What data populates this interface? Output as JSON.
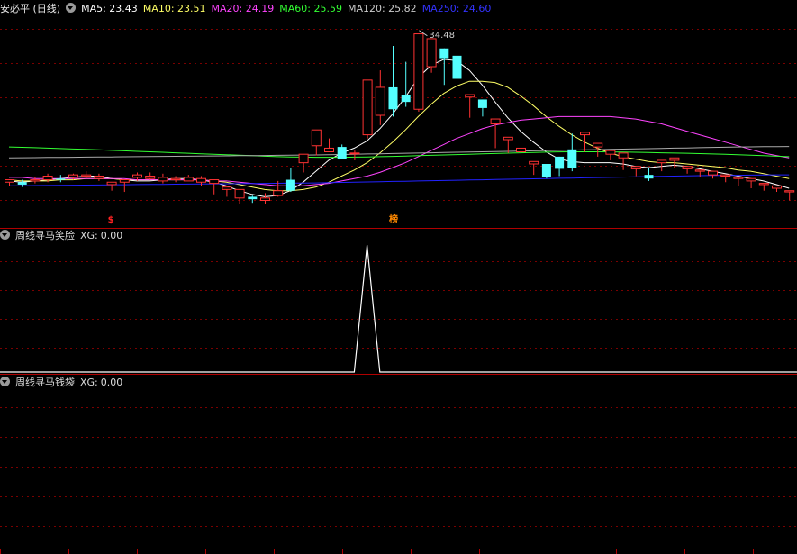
{
  "main": {
    "title": "安必平 (日线)",
    "ma": [
      {
        "label": "MA5:",
        "value": "23.43",
        "color": "#ffffff"
      },
      {
        "label": "MA10:",
        "value": "23.51",
        "color": "#ffff66"
      },
      {
        "label": "MA20:",
        "value": "24.19",
        "color": "#ff44ff"
      },
      {
        "label": "MA60:",
        "value": "25.59",
        "color": "#33ff33"
      },
      {
        "label": "MA120:",
        "value": "25.82",
        "color": "#cccccc"
      },
      {
        "label": "MA250:",
        "value": "24.60",
        "color": "#3333ff"
      }
    ],
    "peak_label": "34.48",
    "markers": [
      {
        "text": "$",
        "color": "#ff2222",
        "bar": 8
      },
      {
        "text": "榜",
        "color": "#ff8800",
        "bar": 30
      }
    ]
  },
  "panel2": {
    "title": "周线寻马笑脸",
    "xg_label": "XG:",
    "xg_value": "0.00"
  },
  "panel3": {
    "title": "周线寻马钱袋",
    "xg_label": "XG:",
    "xg_value": "0.00"
  },
  "chart_data": [
    {
      "type": "candlestick",
      "y_range": [
        19.5,
        35.5
      ],
      "candles": [
        [
          22.0,
          22.2,
          21.9,
          21.7
        ],
        [
          22.0,
          21.8,
          22.2,
          21.6
        ],
        [
          22.1,
          22.2,
          21.9,
          22.4
        ],
        [
          22.2,
          22.5,
          22.0,
          22.7
        ],
        [
          22.3,
          22.2,
          22.6,
          22.0
        ],
        [
          22.4,
          22.6,
          22.2,
          22.7
        ],
        [
          22.5,
          22.6,
          22.3,
          22.9
        ],
        [
          22.3,
          22.5,
          22.1,
          22.7
        ],
        [
          21.8,
          22.0,
          21.5,
          21.3
        ],
        [
          22.0,
          22.2,
          21.4,
          21.2
        ],
        [
          22.4,
          22.6,
          22.1,
          22.8
        ],
        [
          22.3,
          22.5,
          22.2,
          22.8
        ],
        [
          22.1,
          22.4,
          21.9,
          22.7
        ],
        [
          22.2,
          22.3,
          22.5,
          22.0
        ],
        [
          22.1,
          22.4,
          22.2,
          22.6
        ],
        [
          22.0,
          22.3,
          21.7,
          22.5
        ],
        [
          21.9,
          22.2,
          21.2,
          21.0
        ],
        [
          21.4,
          21.6,
          21.0,
          20.8
        ],
        [
          20.7,
          21.4,
          20.4,
          20.2
        ],
        [
          20.8,
          20.6,
          20.9,
          20.3
        ],
        [
          20.5,
          20.7,
          21.1,
          20.2
        ],
        [
          20.9,
          21.3,
          22.1,
          20.8
        ],
        [
          22.2,
          21.3,
          23.2,
          21.2
        ],
        [
          23.6,
          24.3,
          22.8,
          22.8
        ],
        [
          25.0,
          26.3,
          24.4,
          24.2
        ],
        [
          24.5,
          24.8,
          24.6,
          25.6
        ],
        [
          24.9,
          23.9,
          24.5,
          25.1
        ],
        [
          24.4,
          24.4,
          24.6,
          23.8
        ],
        [
          25.9,
          30.4,
          27.2,
          25.6
        ],
        [
          27.5,
          29.8,
          31.2,
          26.7
        ],
        [
          29.8,
          28.0,
          33.2,
          27.4
        ],
        [
          29.2,
          28.6,
          31.9,
          28.2
        ],
        [
          28.0,
          34.2,
          32.6,
          27.8
        ],
        [
          31.5,
          33.8,
          33.3,
          31.0
        ],
        [
          33.0,
          32.2,
          30.2,
          30.0
        ],
        [
          32.4,
          30.5,
          28.4,
          28.2
        ],
        [
          29.0,
          29.2,
          27.9,
          27.3
        ],
        [
          28.8,
          28.1,
          27.4,
          27.5
        ],
        [
          26.8,
          27.2,
          25.0,
          24.8
        ],
        [
          25.5,
          25.7,
          24.6,
          24.4
        ],
        [
          24.5,
          24.8,
          23.8,
          23.6
        ],
        [
          23.5,
          23.7,
          22.8,
          22.6
        ],
        [
          23.5,
          22.4,
          23.0,
          22.3
        ],
        [
          24.1,
          23.1,
          22.7,
          22.5
        ],
        [
          24.7,
          23.2,
          26.0,
          22.9
        ],
        [
          25.9,
          26.1,
          24.8,
          24.5
        ],
        [
          24.9,
          25.2,
          24.3,
          24.1
        ],
        [
          24.3,
          24.6,
          24.0,
          23.8
        ],
        [
          24.0,
          24.4,
          23.2,
          23.0
        ],
        [
          23.1,
          23.3,
          22.7,
          22.5
        ],
        [
          22.6,
          22.3,
          23.2,
          22.1
        ],
        [
          23.6,
          23.8,
          23.2,
          22.9
        ],
        [
          23.8,
          24.0,
          23.5,
          23.2
        ],
        [
          23.1,
          23.3,
          22.9,
          22.7
        ],
        [
          22.9,
          23.0,
          22.6,
          22.4
        ],
        [
          22.6,
          22.9,
          22.3,
          22.5
        ],
        [
          22.5,
          22.6,
          22.2,
          22.0
        ],
        [
          22.3,
          22.4,
          21.9,
          21.7
        ],
        [
          22.1,
          22.3,
          21.7,
          21.5
        ],
        [
          21.8,
          21.9,
          21.6,
          21.3
        ],
        [
          21.5,
          21.7,
          21.4,
          21.2
        ],
        [
          21.2,
          21.3,
          20.7,
          20.5
        ]
      ],
      "ma_series": [
        {
          "name": "MA5",
          "color": "#ffffff",
          "values": [
            22.1,
            22.0,
            22.1,
            22.2,
            22.3,
            22.4,
            22.5,
            22.5,
            22.3,
            22.2,
            22.1,
            22.1,
            22.2,
            22.3,
            22.3,
            22.2,
            22.0,
            21.7,
            21.3,
            21.0,
            20.8,
            20.9,
            21.3,
            22.0,
            22.9,
            23.8,
            24.4,
            24.8,
            25.4,
            26.4,
            27.6,
            29.0,
            30.6,
            31.6,
            32.1,
            32.0,
            31.2,
            30.0,
            28.6,
            27.3,
            26.2,
            25.3,
            24.5,
            23.9,
            23.7,
            23.6,
            23.6,
            23.6,
            23.5,
            23.3,
            23.2,
            23.3,
            23.4,
            23.3,
            23.1,
            22.9,
            22.7,
            22.5,
            22.3,
            22.1,
            21.8,
            21.5
          ]
        },
        {
          "name": "MA10",
          "color": "#ffff66",
          "values": [
            22.2,
            22.1,
            22.1,
            22.1,
            22.2,
            22.2,
            22.3,
            22.3,
            22.3,
            22.2,
            22.2,
            22.2,
            22.2,
            22.2,
            22.2,
            22.2,
            22.1,
            22.0,
            21.8,
            21.6,
            21.4,
            21.3,
            21.3,
            21.4,
            21.6,
            22.0,
            22.5,
            23.0,
            23.6,
            24.4,
            25.3,
            26.3,
            27.4,
            28.4,
            29.3,
            29.9,
            30.3,
            30.3,
            30.2,
            29.8,
            29.1,
            28.3,
            27.4,
            26.6,
            25.9,
            25.3,
            24.8,
            24.4,
            24.1,
            23.9,
            23.7,
            23.6,
            23.6,
            23.5,
            23.4,
            23.3,
            23.2,
            23.0,
            22.9,
            22.7,
            22.5,
            22.3
          ]
        },
        {
          "name": "MA20",
          "color": "#ff44ff",
          "values": [
            22.4,
            22.4,
            22.3,
            22.3,
            22.3,
            22.3,
            22.3,
            22.3,
            22.3,
            22.3,
            22.2,
            22.2,
            22.2,
            22.2,
            22.2,
            22.2,
            22.1,
            22.1,
            22.0,
            21.9,
            21.8,
            21.7,
            21.7,
            21.7,
            21.8,
            21.9,
            22.1,
            22.3,
            22.5,
            22.8,
            23.2,
            23.6,
            24.1,
            24.6,
            25.1,
            25.6,
            26.0,
            26.4,
            26.7,
            26.9,
            27.1,
            27.2,
            27.3,
            27.4,
            27.4,
            27.4,
            27.4,
            27.4,
            27.3,
            27.2,
            27.0,
            26.8,
            26.5,
            26.2,
            25.9,
            25.6,
            25.3,
            25.0,
            24.7,
            24.4,
            24.2,
            24.0
          ]
        },
        {
          "name": "MA60",
          "color": "#33ff33",
          "values": [
            24.9,
            24.87,
            24.84,
            24.8,
            24.77,
            24.73,
            24.7,
            24.66,
            24.62,
            24.58,
            24.54,
            24.5,
            24.46,
            24.42,
            24.38,
            24.34,
            24.3,
            24.26,
            24.22,
            24.18,
            24.14,
            24.1,
            24.08,
            24.06,
            24.05,
            24.05,
            24.05,
            24.06,
            24.08,
            24.1,
            24.12,
            24.15,
            24.18,
            24.21,
            24.24,
            24.27,
            24.3,
            24.33,
            24.36,
            24.39,
            24.42,
            24.45,
            24.47,
            24.49,
            24.5,
            24.5,
            24.5,
            24.49,
            24.48,
            24.46,
            24.44,
            24.42,
            24.4,
            24.38,
            24.35,
            24.32,
            24.29,
            24.26,
            24.22,
            24.18,
            24.14,
            24.1
          ]
        },
        {
          "name": "MA120",
          "color": "#aaaaaa",
          "values": [
            24.0,
            24.01,
            24.02,
            24.03,
            24.04,
            24.05,
            24.06,
            24.07,
            24.08,
            24.09,
            24.1,
            24.11,
            24.12,
            24.13,
            24.14,
            24.15,
            24.16,
            24.17,
            24.18,
            24.19,
            24.2,
            24.21,
            24.22,
            24.23,
            24.24,
            24.26,
            24.28,
            24.3,
            24.32,
            24.34,
            24.36,
            24.38,
            24.4,
            24.42,
            24.44,
            24.46,
            24.48,
            24.5,
            24.52,
            24.54,
            24.56,
            24.58,
            24.6,
            24.62,
            24.64,
            24.66,
            24.68,
            24.7,
            24.72,
            24.74,
            24.76,
            24.78,
            24.8,
            24.82,
            24.84,
            24.86,
            24.88,
            24.9,
            24.91,
            24.92,
            24.93,
            24.94
          ]
        },
        {
          "name": "MA250",
          "color": "#2222ff",
          "values": [
            21.7,
            21.71,
            21.72,
            21.73,
            21.74,
            21.75,
            21.76,
            21.77,
            21.78,
            21.79,
            21.8,
            21.81,
            21.82,
            21.83,
            21.84,
            21.85,
            21.86,
            21.87,
            21.88,
            21.89,
            21.9,
            21.91,
            21.92,
            21.93,
            21.94,
            21.96,
            21.98,
            22.0,
            22.02,
            22.04,
            22.06,
            22.08,
            22.1,
            22.12,
            22.14,
            22.16,
            22.18,
            22.2,
            22.22,
            22.24,
            22.26,
            22.28,
            22.3,
            22.32,
            22.34,
            22.36,
            22.38,
            22.4,
            22.42,
            22.44,
            22.46,
            22.48,
            22.5,
            22.52,
            22.54,
            22.55,
            22.56,
            22.57,
            22.58,
            22.59,
            22.6,
            22.6
          ]
        }
      ]
    },
    {
      "type": "line",
      "title": "周线寻马笑脸",
      "y_range": [
        0,
        1
      ],
      "signal_bar": 28,
      "values_note_free": true,
      "xg_series": [
        0,
        0,
        0,
        0,
        0,
        0,
        0,
        0,
        0,
        0,
        0,
        0,
        0,
        0,
        0,
        0,
        0,
        0,
        0,
        0,
        0,
        0,
        0,
        0,
        0,
        0,
        0,
        0,
        1,
        0,
        0,
        0,
        0,
        0,
        0,
        0,
        0,
        0,
        0,
        0,
        0,
        0,
        0,
        0,
        0,
        0,
        0,
        0,
        0,
        0,
        0,
        0,
        0,
        0,
        0,
        0,
        0,
        0,
        0,
        0,
        0,
        0
      ]
    },
    {
      "type": "line",
      "title": "周线寻马钱袋",
      "y_range": [
        0,
        1
      ],
      "xg_series": []
    }
  ]
}
